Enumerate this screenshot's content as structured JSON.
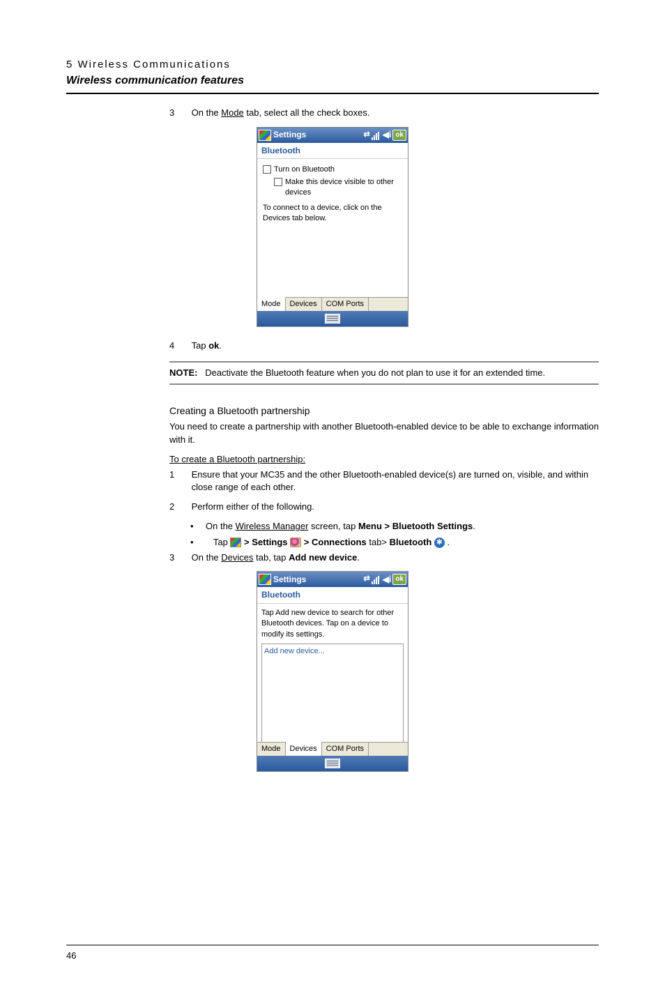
{
  "header": {
    "chapter": "5 Wireless Communications",
    "section": "Wireless communication features"
  },
  "step3": {
    "num": "3",
    "text_pre": "On the ",
    "mode": "Mode",
    "text_post": " tab, select all the check boxes."
  },
  "screen1": {
    "title": "Settings",
    "ok": "ok",
    "bluetooth": "Bluetooth",
    "chk1": "Turn on Bluetooth",
    "chk2": "Make this device visible to other devices",
    "info": "To connect to a device, click on the Devices tab below.",
    "tab_mode": "Mode",
    "tab_devices": "Devices",
    "tab_com": "COM Ports"
  },
  "step4": {
    "num": "4",
    "text": "Tap ",
    "ok": "ok",
    "period": "."
  },
  "note": {
    "label": "NOTE:",
    "text": "Deactivate the Bluetooth feature when you do not plan to use it for an extended time."
  },
  "partnership": {
    "heading": "Creating a Bluetooth partnership",
    "intro": "You need to create a partnership with another Bluetooth-enabled device to be able to exchange information with it.",
    "proc_head": "To create a Bluetooth partnership:",
    "s1_num": "1",
    "s1": "Ensure that your MC35 and the other Bluetooth-enabled device(s) are turned on, visible, and within close range of each other.",
    "s2_num": "2",
    "s2": "Perform either of the following.",
    "b1_pre": "On the ",
    "b1_wm": "Wireless Manager",
    "b1_mid": " screen, tap ",
    "b1_menu": "Menu > Bluetooth Settings",
    "b1_post": ".",
    "b2_tap": "Tap ",
    "b2_gt1": " > ",
    "b2_settings": "Settings",
    "b2_gt2": " > Connections",
    "b2_tab": " tab> ",
    "b2_bt": "Bluetooth",
    "b2_post": " .",
    "s3_num": "3",
    "s3_pre": "On the ",
    "s3_dev": "Devices",
    "s3_mid": " tab, tap ",
    "s3_add": "Add new device",
    "s3_post": "."
  },
  "screen2": {
    "title": "Settings",
    "ok": "ok",
    "bluetooth": "Bluetooth",
    "msg": "Tap Add new device to search for other Bluetooth devices. Tap on a device to modify its settings.",
    "item": "Add new device...",
    "tab_mode": "Mode",
    "tab_devices": "Devices",
    "tab_com": "COM Ports"
  },
  "page_number": "46"
}
